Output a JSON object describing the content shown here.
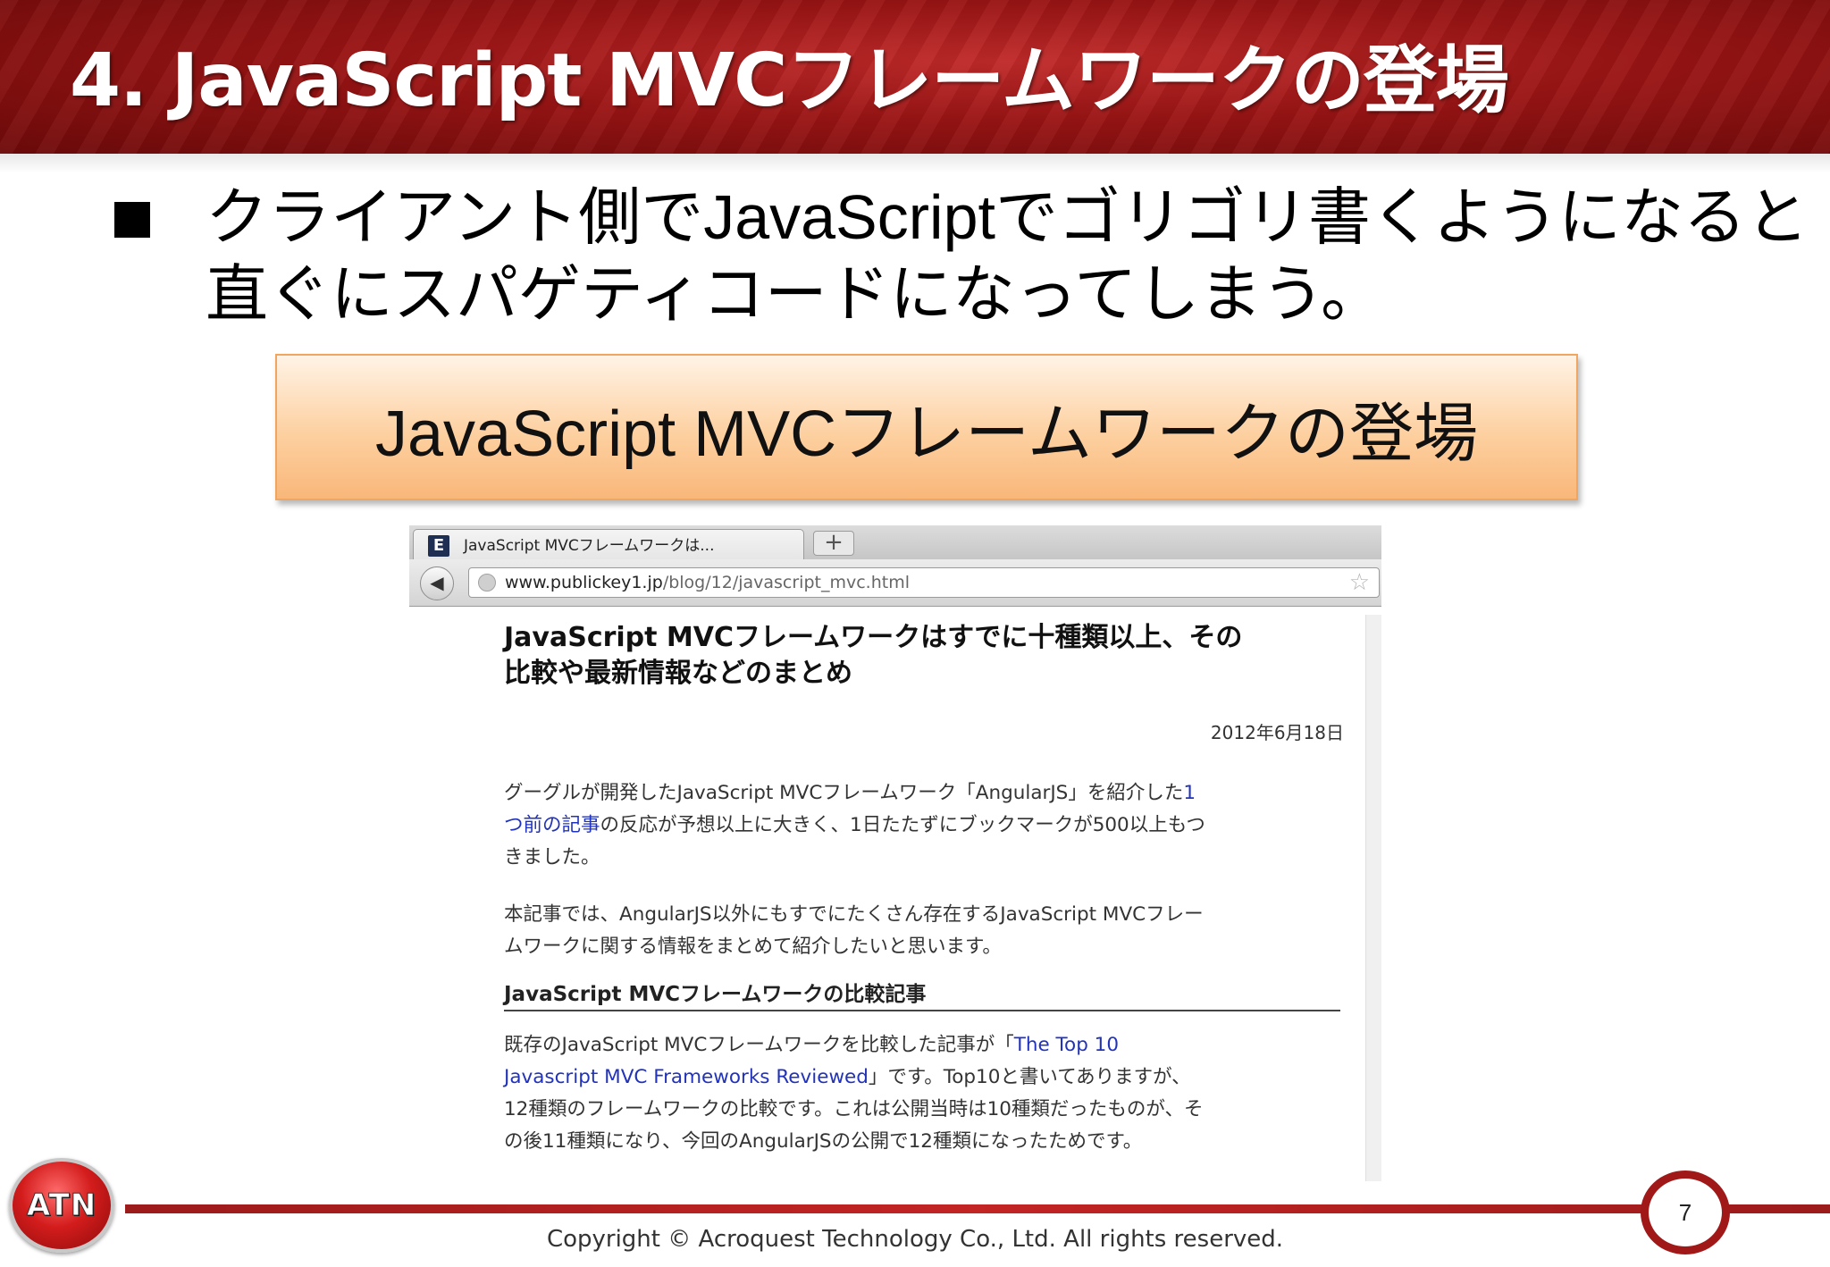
{
  "slide": {
    "title": "4. JavaScript MVCフレームワークの登場",
    "bullet_lines": [
      "クライアント側でJavaScriptでゴリゴリ書くようになると",
      "直ぐにスパゲティコードになってしまう。"
    ],
    "callout": "JavaScript MVCフレームワークの登場"
  },
  "browser": {
    "tab_title": "JavaScript MVCフレームワークは...",
    "new_tab_symbol": "+",
    "back_symbol": "◀",
    "url_domain": "www.publickey1.jp",
    "url_path": "/blog/12/javascript_mvc.html",
    "star_symbol": "☆",
    "favicon_letter": "E"
  },
  "article": {
    "title_lines": [
      "JavaScript MVCフレームワークはすでに十種類以上、その",
      "比較や最新情報などのまとめ"
    ],
    "date": "2012年6月18日",
    "p1": {
      "line1_pre": "グーグルが開発したJavaScript MVCフレームワーク「AngularJS」を紹介した",
      "line1_link": "1",
      "line2_link": "つ前の記事",
      "line2_post": "の反応が予想以上に大きく、1日たたずにブックマークが500以上もつ",
      "line3": "きました。"
    },
    "p2_lines": [
      "本記事では、AngularJS以外にもすでにたくさん存在するJavaScript MVCフレー",
      "ムワークに関する情報をまとめて紹介したいと思います。"
    ],
    "h2": "JavaScript MVCフレームワークの比較記事",
    "p3": {
      "line1_pre": "既存のJavaScript MVCフレームワークを比較した記事が「",
      "line1_link": "The Top 10",
      "line2_link": "Javascript MVC Frameworks Reviewed",
      "line2_post": "」です。Top10と書いてありますが、",
      "line3": "12種類のフレームワークの比較です。これは公開当時は10種類だったものが、そ",
      "line4": "の後11種類になり、今回のAngularJSの公開で12種類になったためです。"
    }
  },
  "footer": {
    "logo_text": "ATN",
    "page_number": "7",
    "copyright": "Copyright © Acroquest Technology Co., Ltd. All rights reserved."
  }
}
